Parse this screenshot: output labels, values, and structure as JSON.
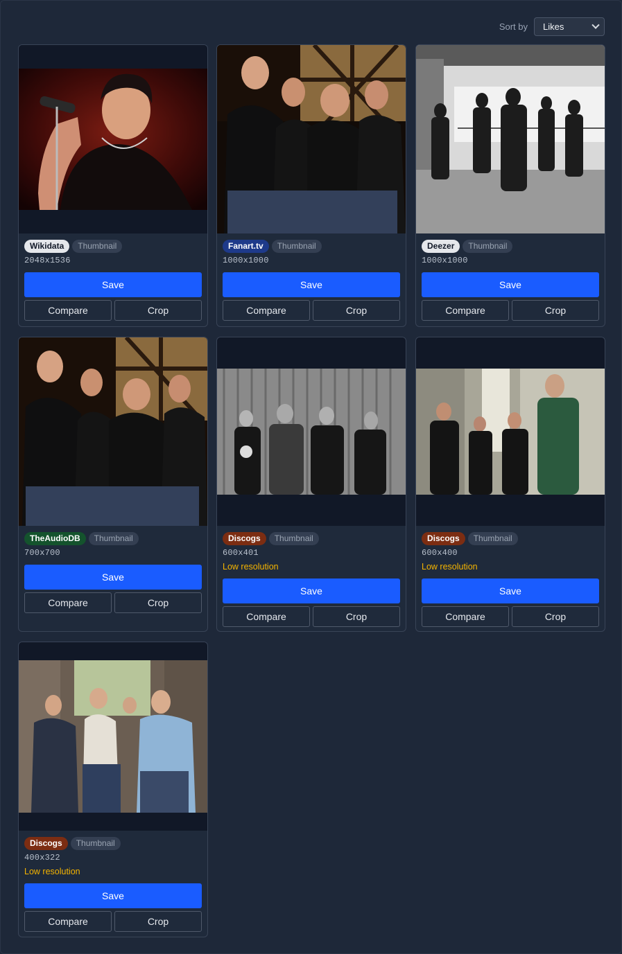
{
  "toolbar": {
    "sort_label": "Sort by",
    "sort_value": "Likes"
  },
  "cards": [
    {
      "source": "Wikidata",
      "source_color": "#e5e7eb",
      "source_text": "#111827",
      "type": "Thumbnail",
      "dims": "2048x1536",
      "low_res": "",
      "save": "Save",
      "compare": "Compare",
      "crop": "Crop"
    },
    {
      "source": "Fanart.tv",
      "source_color": "#1e3a8a",
      "source_text": "#ffffff",
      "type": "Thumbnail",
      "dims": "1000x1000",
      "low_res": "",
      "save": "Save",
      "compare": "Compare",
      "crop": "Crop"
    },
    {
      "source": "Deezer",
      "source_color": "#e5e7eb",
      "source_text": "#111827",
      "type": "Thumbnail",
      "dims": "1000x1000",
      "low_res": "",
      "save": "Save",
      "compare": "Compare",
      "crop": "Crop"
    },
    {
      "source": "TheAudioDB",
      "source_color": "#14532d",
      "source_text": "#ffffff",
      "type": "Thumbnail",
      "dims": "700x700",
      "low_res": "",
      "save": "Save",
      "compare": "Compare",
      "crop": "Crop"
    },
    {
      "source": "Discogs",
      "source_color": "#7c2d12",
      "source_text": "#ffffff",
      "type": "Thumbnail",
      "dims": "600x401",
      "low_res": "Low resolution",
      "save": "Save",
      "compare": "Compare",
      "crop": "Crop"
    },
    {
      "source": "Discogs",
      "source_color": "#7c2d12",
      "source_text": "#ffffff",
      "type": "Thumbnail",
      "dims": "600x400",
      "low_res": "Low resolution",
      "save": "Save",
      "compare": "Compare",
      "crop": "Crop"
    },
    {
      "source": "Discogs",
      "source_color": "#7c2d12",
      "source_text": "#ffffff",
      "type": "Thumbnail",
      "dims": "400x322",
      "low_res": "Low resolution",
      "save": "Save",
      "compare": "Compare",
      "crop": "Crop"
    }
  ]
}
